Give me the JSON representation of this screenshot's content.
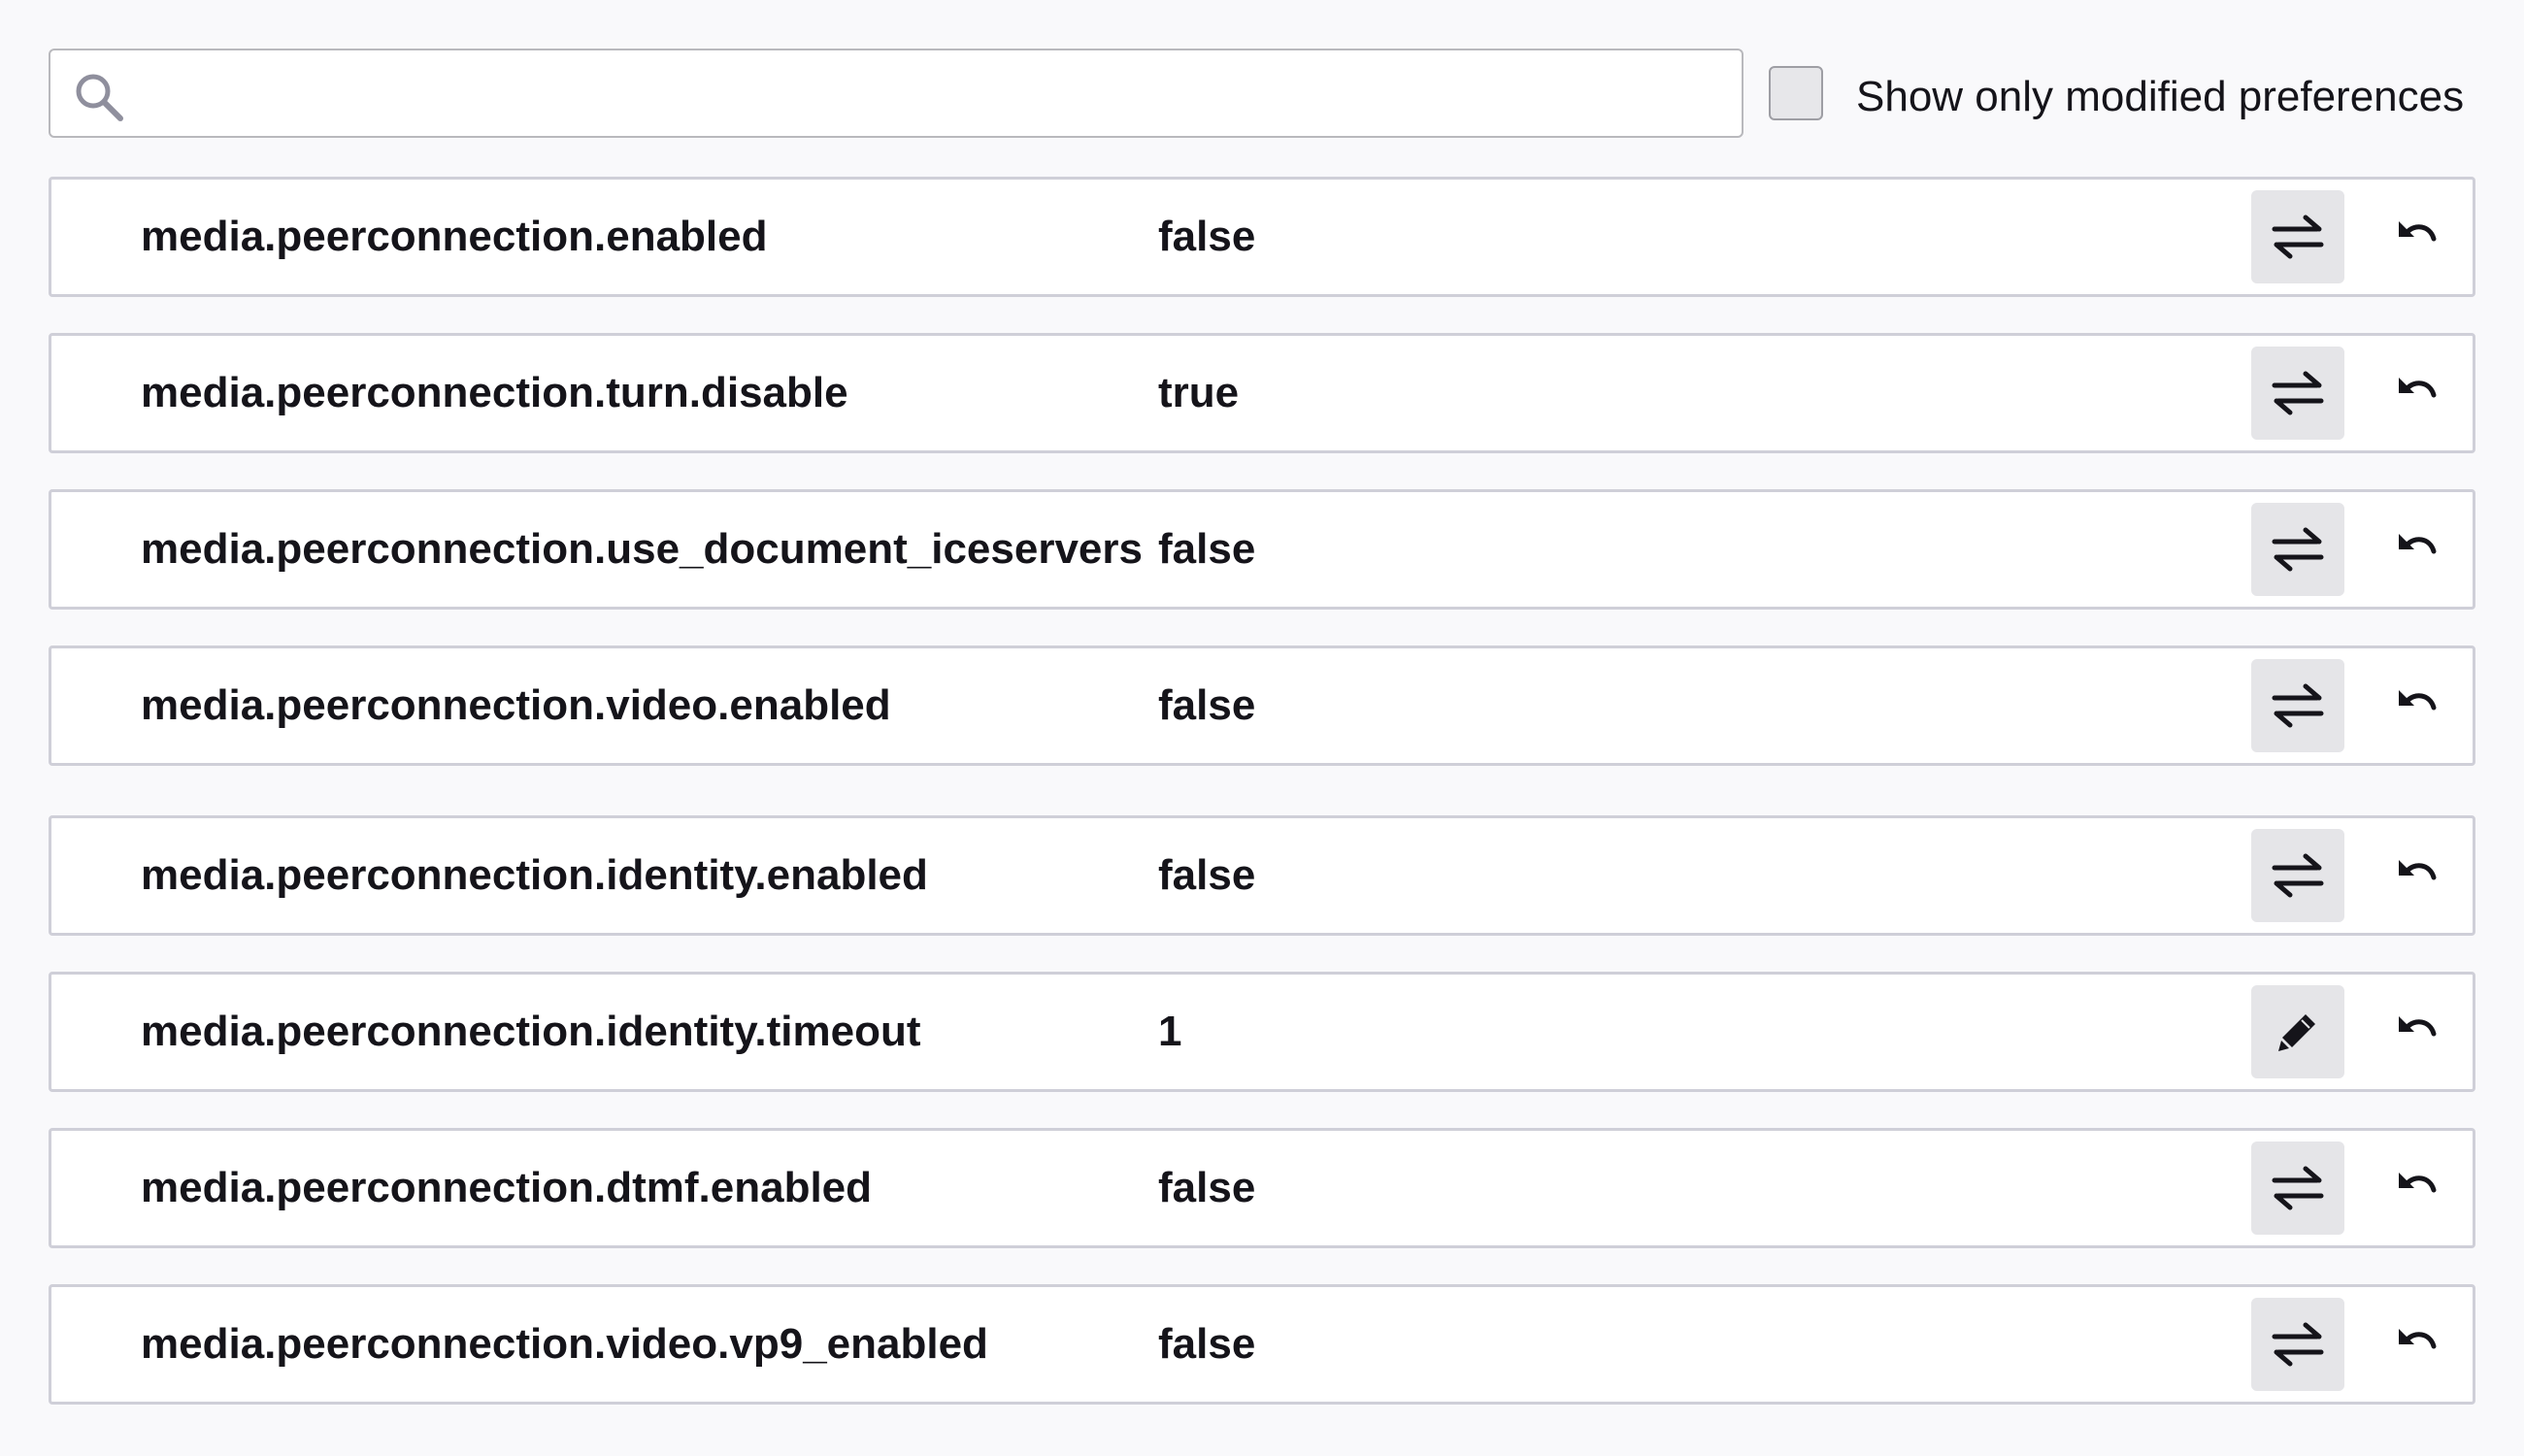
{
  "toolbar": {
    "search_value": "",
    "search_icon": "search-icon",
    "show_modified_label": "Show only modified preferences",
    "show_modified_checked": false
  },
  "preferences": [
    {
      "name": "media.peerconnection.enabled",
      "value": "false",
      "action_icon": "toggle-icon"
    },
    {
      "name": "media.peerconnection.turn.disable",
      "value": "true",
      "action_icon": "toggle-icon"
    },
    {
      "name": "media.peerconnection.use_document_iceservers",
      "value": "false",
      "action_icon": "toggle-icon"
    },
    {
      "name": "media.peerconnection.video.enabled",
      "value": "false",
      "action_icon": "toggle-icon"
    },
    {
      "name": "media.peerconnection.identity.enabled",
      "value": "false",
      "action_icon": "toggle-icon"
    },
    {
      "name": "media.peerconnection.identity.timeout",
      "value": "1",
      "action_icon": "edit-icon"
    },
    {
      "name": "media.peerconnection.dtmf.enabled",
      "value": "false",
      "action_icon": "toggle-icon"
    },
    {
      "name": "media.peerconnection.video.vp9_enabled",
      "value": "false",
      "action_icon": "toggle-icon"
    }
  ],
  "colors": {
    "page_background": "#f9f9fb",
    "row_background": "#ffffff",
    "row_border": "#cfcfd8",
    "button_background": "#e5e5e8",
    "text": "#15141a"
  }
}
